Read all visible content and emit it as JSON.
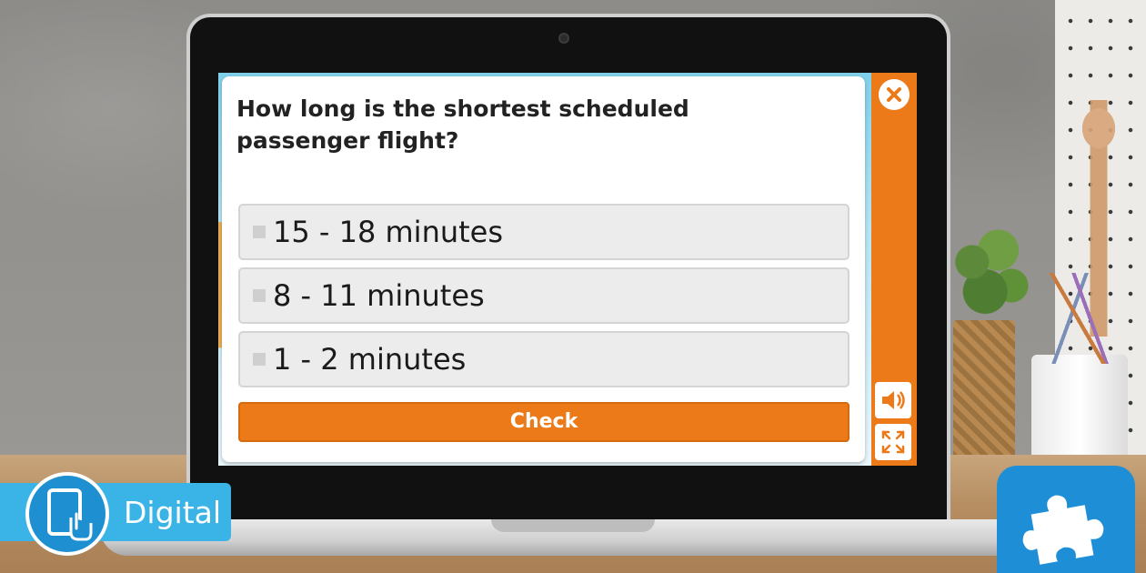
{
  "quiz": {
    "question": "How long is the shortest scheduled passenger flight?",
    "options": [
      {
        "label": "15 - 18 minutes"
      },
      {
        "label": "8 - 11 minutes"
      },
      {
        "label": "1 - 2 minutes"
      }
    ],
    "check_label": "Check"
  },
  "controls": {
    "close_icon": "close-icon",
    "sound_icon": "speaker-icon",
    "fullscreen_icon": "fullscreen-icon",
    "accent_color": "#ec7a18"
  },
  "badges": {
    "digital_label": "Digital",
    "digital_icon": "tablet-touch-icon",
    "puzzle_icon": "puzzle-piece-icon",
    "badge_color": "#3ab4e6"
  }
}
